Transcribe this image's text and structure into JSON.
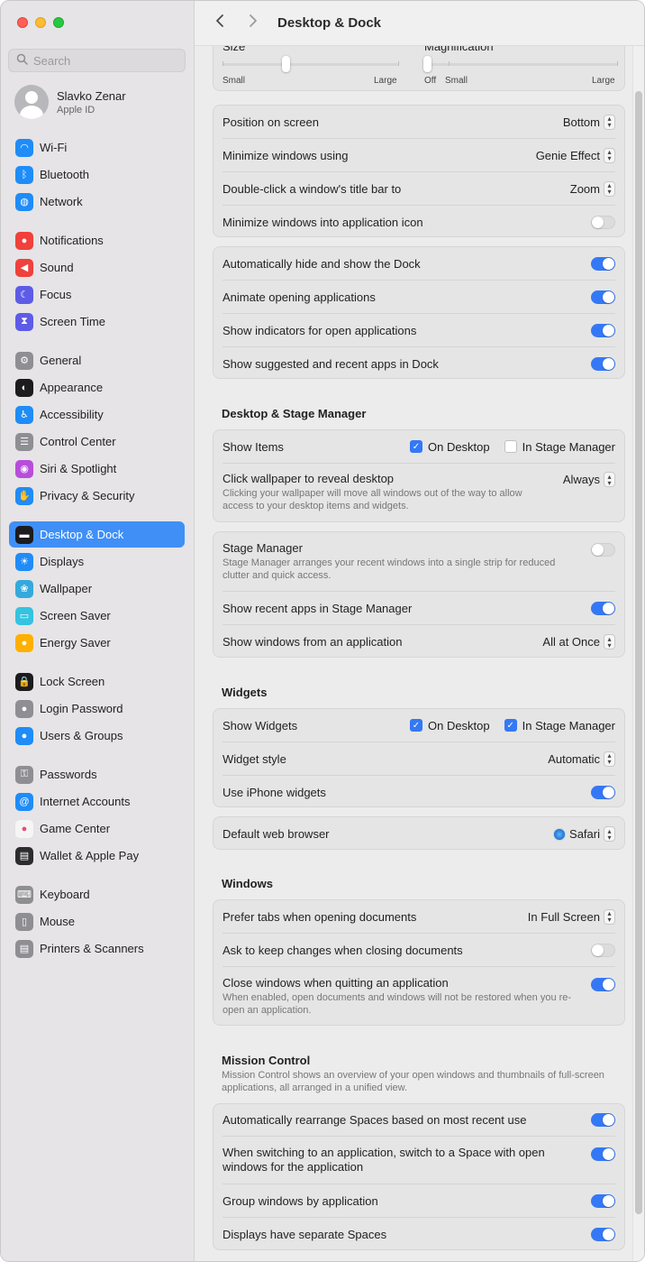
{
  "window": {
    "title": "Desktop & Dock"
  },
  "search": {
    "placeholder": "Search"
  },
  "profile": {
    "name": "Slavko Zenar",
    "subtitle": "Apple ID"
  },
  "sidebar": {
    "items": [
      {
        "label": "Wi-Fi",
        "icon": "wifi-icon",
        "color": "#1f8cf7"
      },
      {
        "label": "Bluetooth",
        "icon": "bluetooth-icon",
        "color": "#1f8cf7"
      },
      {
        "label": "Network",
        "icon": "globe-icon",
        "color": "#1f8cf7"
      },
      {
        "label": "Notifications",
        "icon": "bell-icon",
        "color": "#f0413b"
      },
      {
        "label": "Sound",
        "icon": "speaker-icon",
        "color": "#f0413b"
      },
      {
        "label": "Focus",
        "icon": "moon-icon",
        "color": "#5e5ce6"
      },
      {
        "label": "Screen Time",
        "icon": "hourglass-icon",
        "color": "#5e5ce6"
      },
      {
        "label": "General",
        "icon": "gear-icon",
        "color": "#8e8e93"
      },
      {
        "label": "Appearance",
        "icon": "appearance-icon",
        "color": "#1c1c1e"
      },
      {
        "label": "Accessibility",
        "icon": "accessibility-icon",
        "color": "#1f8cf7"
      },
      {
        "label": "Control Center",
        "icon": "control-center-icon",
        "color": "#8e8e93"
      },
      {
        "label": "Siri & Spotlight",
        "icon": "siri-icon",
        "color": "#b84ddb"
      },
      {
        "label": "Privacy & Security",
        "icon": "hand-icon",
        "color": "#1f8cf7"
      },
      {
        "label": "Desktop & Dock",
        "icon": "dock-icon",
        "color": "#1c1c1e"
      },
      {
        "label": "Displays",
        "icon": "sun-icon",
        "color": "#1f8cf7"
      },
      {
        "label": "Wallpaper",
        "icon": "wallpaper-icon",
        "color": "#34aadc"
      },
      {
        "label": "Screen Saver",
        "icon": "screensaver-icon",
        "color": "#34c3e0"
      },
      {
        "label": "Energy Saver",
        "icon": "lightbulb-icon",
        "color": "#ffb000"
      },
      {
        "label": "Lock Screen",
        "icon": "lock-icon",
        "color": "#1c1c1e"
      },
      {
        "label": "Login Password",
        "icon": "key-icon",
        "color": "#8e8e93"
      },
      {
        "label": "Users & Groups",
        "icon": "users-icon",
        "color": "#1f8cf7"
      },
      {
        "label": "Passwords",
        "icon": "passwords-icon",
        "color": "#8e8e93"
      },
      {
        "label": "Internet Accounts",
        "icon": "at-icon",
        "color": "#1f8cf7"
      },
      {
        "label": "Game Center",
        "icon": "game-center-icon",
        "color": "#f5f5f5"
      },
      {
        "label": "Wallet & Apple Pay",
        "icon": "wallet-icon",
        "color": "#2c2c2e"
      },
      {
        "label": "Keyboard",
        "icon": "keyboard-icon",
        "color": "#8e8e93"
      },
      {
        "label": "Mouse",
        "icon": "mouse-icon",
        "color": "#8e8e93"
      },
      {
        "label": "Printers & Scanners",
        "icon": "printer-icon",
        "color": "#8e8e93"
      }
    ]
  },
  "dock_size": {
    "size_label": "Size",
    "size_min": "Small",
    "size_max": "Large",
    "size_level": 0.36,
    "magnification_label": "Magnification",
    "mag_off": "Off",
    "mag_min": "Small",
    "mag_max": "Large",
    "mag_level": 0.0
  },
  "dock_options": {
    "position_label": "Position on screen",
    "position_value": "Bottom",
    "minimize_label": "Minimize windows using",
    "minimize_value": "Genie Effect",
    "doubleclick_label": "Double-click a window's title bar to",
    "doubleclick_value": "Zoom",
    "minimize_icon_label": "Minimize windows into application icon",
    "minimize_icon_on": false
  },
  "dock_toggles": [
    {
      "label": "Automatically hide and show the Dock",
      "on": true
    },
    {
      "label": "Animate opening applications",
      "on": true
    },
    {
      "label": "Show indicators for open applications",
      "on": true
    },
    {
      "label": "Show suggested and recent apps in Dock",
      "on": true
    }
  ],
  "stage": {
    "heading": "Desktop & Stage Manager",
    "show_items_label": "Show Items",
    "on_desktop": "On Desktop",
    "in_stage_manager": "In Stage Manager",
    "show_items_desktop": true,
    "show_items_stage": false,
    "click_wallpaper_label": "Click wallpaper to reveal desktop",
    "click_wallpaper_desc": "Clicking your wallpaper will move all windows out of the way to allow access to your desktop items and widgets.",
    "click_wallpaper_value": "Always",
    "stage_manager_label": "Stage Manager",
    "stage_manager_desc": "Stage Manager arranges your recent windows into a single strip for reduced clutter and quick access.",
    "stage_manager_on": false,
    "recent_apps_label": "Show recent apps in Stage Manager",
    "recent_apps_on": true,
    "show_windows_label": "Show windows from an application",
    "show_windows_value": "All at Once"
  },
  "widgets": {
    "heading": "Widgets",
    "show_label": "Show Widgets",
    "on_desktop": "On Desktop",
    "in_stage_manager": "In Stage Manager",
    "show_desktop": true,
    "show_stage": true,
    "style_label": "Widget style",
    "style_value": "Automatic",
    "iphone_label": "Use iPhone widgets",
    "iphone_on": true
  },
  "browser": {
    "label": "Default web browser",
    "value": "Safari"
  },
  "windows": {
    "heading": "Windows",
    "prefer_tabs_label": "Prefer tabs when opening documents",
    "prefer_tabs_value": "In Full Screen",
    "ask_keep_label": "Ask to keep changes when closing documents",
    "ask_keep_on": false,
    "close_windows_label": "Close windows when quitting an application",
    "close_windows_desc": "When enabled, open documents and windows will not be restored when you re-open an application.",
    "close_windows_on": true
  },
  "mission": {
    "heading": "Mission Control",
    "desc": "Mission Control shows an overview of your open windows and thumbnails of full-screen applications, all arranged in a unified view.",
    "rearrange_label": "Automatically rearrange Spaces based on most recent use",
    "rearrange_on": true,
    "switch_label": "When switching to an application, switch to a Space with open windows for the application",
    "switch_on": true,
    "group_label": "Group windows by application",
    "group_on": true,
    "separate_label": "Displays have separate Spaces",
    "separate_on": true
  }
}
